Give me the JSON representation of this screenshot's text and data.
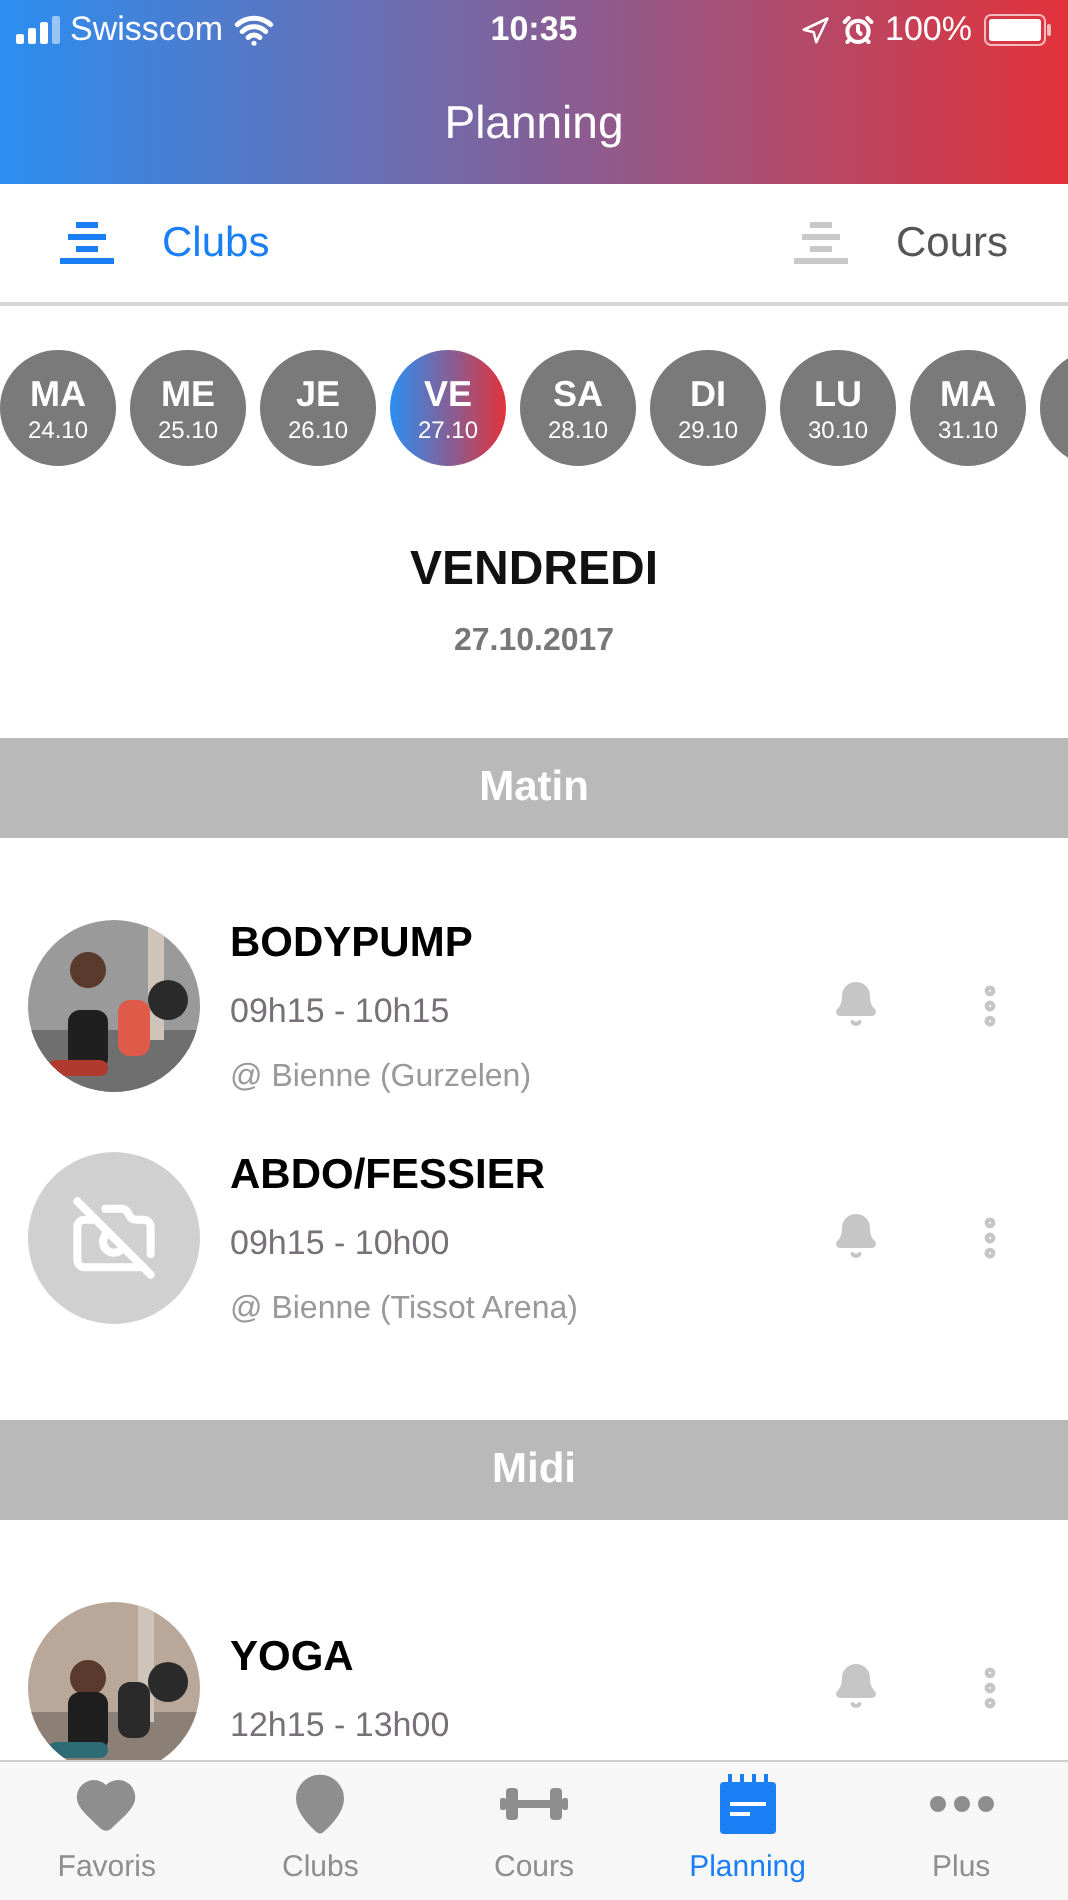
{
  "status_bar": {
    "carrier": "Swisscom",
    "time": "10:35",
    "battery": "100%"
  },
  "nav": {
    "title": "Planning"
  },
  "segments": [
    {
      "label": "Clubs",
      "selected": true
    },
    {
      "label": "Cours",
      "selected": false
    }
  ],
  "days": [
    {
      "day": "MA",
      "date": "24.10",
      "selected": false
    },
    {
      "day": "ME",
      "date": "25.10",
      "selected": false
    },
    {
      "day": "JE",
      "date": "26.10",
      "selected": false
    },
    {
      "day": "VE",
      "date": "27.10",
      "selected": true
    },
    {
      "day": "SA",
      "date": "28.10",
      "selected": false
    },
    {
      "day": "DI",
      "date": "29.10",
      "selected": false
    },
    {
      "day": "LU",
      "date": "30.10",
      "selected": false
    },
    {
      "day": "MA",
      "date": "31.10",
      "selected": false
    }
  ],
  "day_header": {
    "weekday": "VENDREDI",
    "date": "27.10.2017"
  },
  "sections": [
    {
      "title": "Matin",
      "classes": [
        {
          "name": "BODYPUMP",
          "time": "09h15 - 10h15",
          "location": "@ Bienne (Gurzelen)",
          "kind": "picture"
        },
        {
          "name": "ABDO/FESSIER",
          "time": "09h15 - 10h00",
          "location": "@ Bienne (Tissot Arena)",
          "kind": "placeholder"
        }
      ]
    },
    {
      "title": "Midi",
      "classes": [
        {
          "name": "YOGA",
          "time": "12h15 - 13h00",
          "kind": "picture"
        }
      ]
    }
  ],
  "tab_bar": [
    {
      "label": "Favoris",
      "selected": false
    },
    {
      "label": "Clubs",
      "selected": false
    },
    {
      "label": "Cours",
      "selected": false
    },
    {
      "label": "Planning",
      "selected": true
    },
    {
      "label": "Plus",
      "selected": false
    }
  ]
}
